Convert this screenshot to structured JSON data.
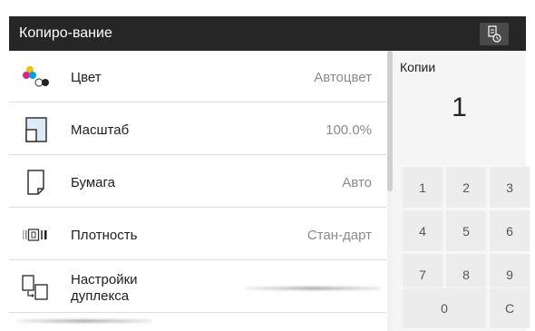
{
  "header": {
    "title": "Копиро-вание",
    "job_icon": "job-list-icon"
  },
  "settings": [
    {
      "id": "color",
      "label": "Цвет",
      "value": "Автоцвет",
      "icon": "color-dots-icon"
    },
    {
      "id": "scale",
      "label": "Масштаб",
      "value": "100.0%",
      "icon": "zoom-icon"
    },
    {
      "id": "paper",
      "label": "Бумага",
      "value": "Авто",
      "icon": "paper-icon"
    },
    {
      "id": "density",
      "label": "Плотность",
      "value": "Стан-дарт",
      "icon": "density-icon"
    },
    {
      "id": "duplex",
      "label": "Настройки дуплекса",
      "value": "",
      "icon": "duplex-icon"
    }
  ],
  "copies": {
    "label": "Копии",
    "value": "1"
  },
  "keypad": {
    "keys": [
      "1",
      "2",
      "3",
      "4",
      "5",
      "6",
      "7",
      "8",
      "9",
      "0",
      "C"
    ]
  },
  "colors": {
    "titlebar": "#262626",
    "panel": "#f5f5f5",
    "key": "#ececec"
  }
}
